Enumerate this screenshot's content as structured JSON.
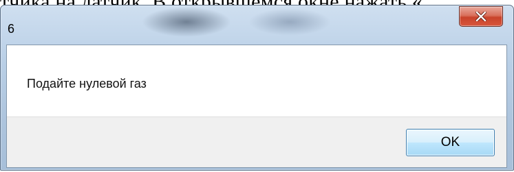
{
  "background": {
    "text": "тчика на датчик. В открывшемся окне нажать «"
  },
  "dialog": {
    "title": "6",
    "message": "Подайте нулевой газ",
    "ok_label": "OK",
    "close_icon": "close-icon",
    "close_color": "#c8432b",
    "accent": "#3c7fb1"
  }
}
